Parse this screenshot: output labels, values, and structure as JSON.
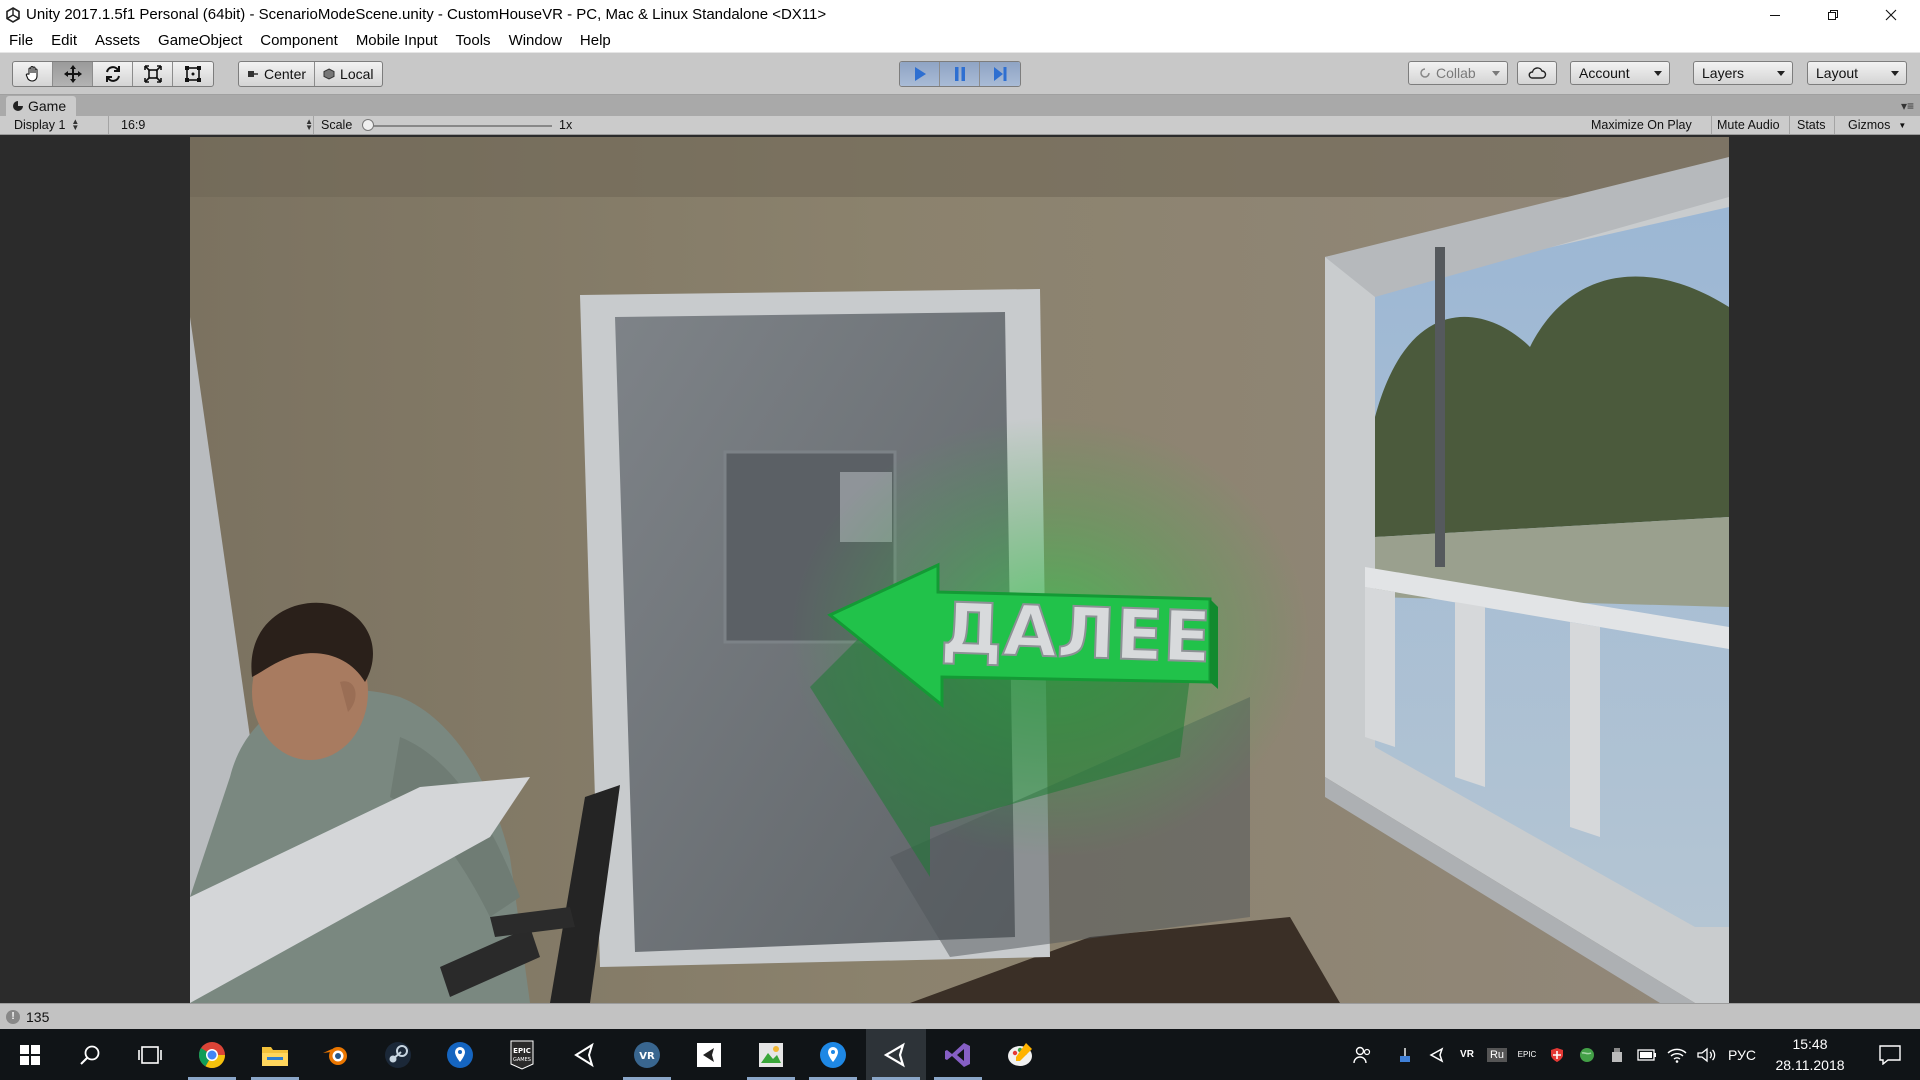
{
  "window": {
    "title": "Unity 2017.1.5f1 Personal (64bit) - ScenarioModeScene.unity - CustomHouseVR - PC, Mac & Linux Standalone <DX11>",
    "minimize_icon": "minimize-icon",
    "maximize_icon": "restore-icon",
    "close_icon": "close-icon"
  },
  "menu": [
    "File",
    "Edit",
    "Assets",
    "GameObject",
    "Component",
    "Mobile Input",
    "Tools",
    "Window",
    "Help"
  ],
  "toolbar": {
    "tools": [
      "hand-icon",
      "move-icon",
      "rotate-icon",
      "scale-icon",
      "rect-icon"
    ],
    "center_label": "Center",
    "local_label": "Local",
    "play_icon": "play-icon",
    "pause_icon": "pause-icon",
    "step_icon": "step-icon",
    "collab_label": "Collab",
    "cloud_icon": "cloud-icon",
    "account_label": "Account",
    "layers_label": "Layers",
    "layout_label": "Layout"
  },
  "game_panel": {
    "tab_label": "Game",
    "display_label": "Display 1",
    "aspect_label": "16:9",
    "scale_label": "Scale",
    "scale_value": "1x",
    "maximize_label": "Maximize On Play",
    "mute_label": "Mute Audio",
    "stats_label": "Stats",
    "gizmos_label": "Gizmos"
  },
  "scene": {
    "sign_text": "ДАЛЕЕ",
    "colors": {
      "wall": "#8a7f6a",
      "door": "#6f7377",
      "arrow": "#21c24a",
      "frame": "#c9ccce"
    }
  },
  "status": {
    "message": "135"
  },
  "taskbar": {
    "apps": [
      "start-icon",
      "search-icon",
      "task-view-icon",
      "chrome-icon",
      "file-explorer-icon",
      "blender-icon",
      "steam-icon",
      "maps-pin-icon",
      "epic-games-icon",
      "unity-hub-icon",
      "vr-icon",
      "unity-editor-icon",
      "image-editor-icon",
      "maps-pin-icon-2",
      "unity-icon",
      "visual-studio-icon",
      "paint-icon"
    ],
    "tray_lang": "РУС",
    "tray_ru": "Ru",
    "tray_vr": "VR",
    "clock_time": "15:48",
    "clock_date": "28.11.2018"
  }
}
